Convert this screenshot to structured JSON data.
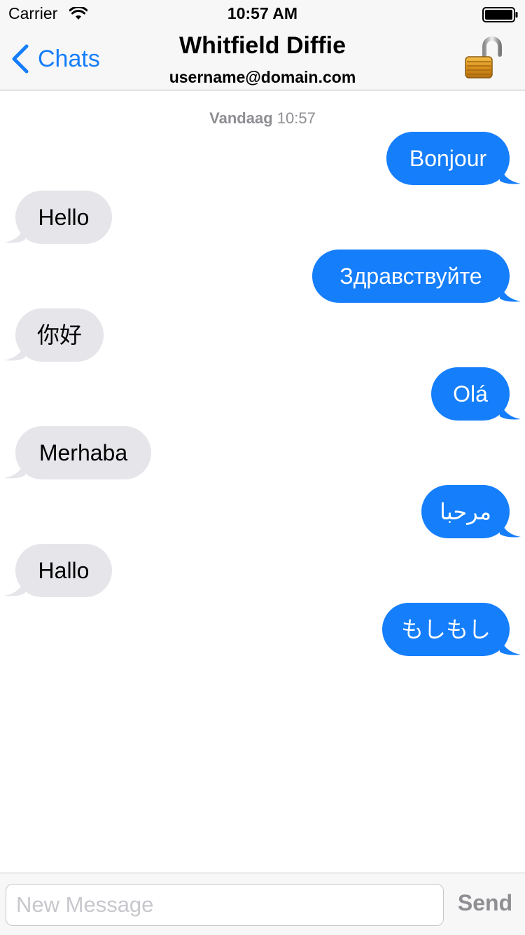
{
  "status_bar": {
    "carrier": "Carrier",
    "time": "10:57 AM",
    "wifi_icon": "wifi-icon",
    "battery_icon": "battery-full-icon"
  },
  "nav_bar": {
    "back_label": "Chats",
    "back_icon": "chevron-left-icon",
    "title": "Whitfield Diffie",
    "subtitle": "username@domain.com",
    "lock_icon": "unlocked-padlock-icon",
    "accent_color": "#157efb"
  },
  "conversation": {
    "timestamp_day": "Vandaag",
    "timestamp_time": "10:57",
    "messages": [
      {
        "direction": "outgoing",
        "text": "Bonjour"
      },
      {
        "direction": "incoming",
        "text": "Hello"
      },
      {
        "direction": "outgoing",
        "text": "Здравствуйте"
      },
      {
        "direction": "incoming",
        "text": "你好"
      },
      {
        "direction": "outgoing",
        "text": "Olá"
      },
      {
        "direction": "incoming",
        "text": "Merhaba"
      },
      {
        "direction": "outgoing",
        "text": "مرحبا"
      },
      {
        "direction": "incoming",
        "text": "Hallo"
      },
      {
        "direction": "outgoing",
        "text": "もしもし"
      }
    ],
    "outgoing_color": "#157efb",
    "incoming_color": "#e5e5ea"
  },
  "input_bar": {
    "placeholder": "New Message",
    "value": "",
    "send_label": "Send"
  }
}
